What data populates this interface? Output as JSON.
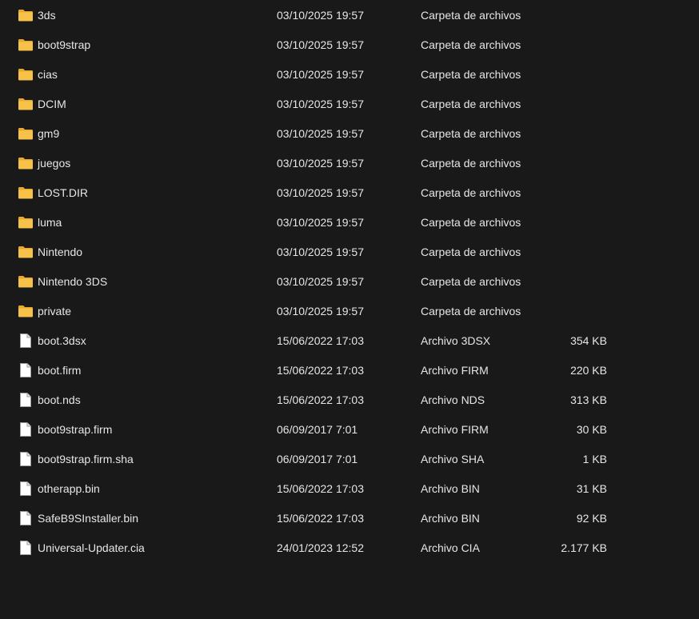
{
  "colors": {
    "background": "#191919",
    "text": "#e6e6e6",
    "folder": "#f7c24a",
    "file_fill": "#ffffff"
  },
  "files": [
    {
      "name": "3ds",
      "date": "03/10/2025 19:57",
      "type": "Carpeta de archivos",
      "size": "",
      "icon": "folder-icon"
    },
    {
      "name": "boot9strap",
      "date": "03/10/2025 19:57",
      "type": "Carpeta de archivos",
      "size": "",
      "icon": "folder-icon"
    },
    {
      "name": "cias",
      "date": "03/10/2025 19:57",
      "type": "Carpeta de archivos",
      "size": "",
      "icon": "folder-icon"
    },
    {
      "name": "DCIM",
      "date": "03/10/2025 19:57",
      "type": "Carpeta de archivos",
      "size": "",
      "icon": "folder-icon"
    },
    {
      "name": "gm9",
      "date": "03/10/2025 19:57",
      "type": "Carpeta de archivos",
      "size": "",
      "icon": "folder-icon"
    },
    {
      "name": "juegos",
      "date": "03/10/2025 19:57",
      "type": "Carpeta de archivos",
      "size": "",
      "icon": "folder-icon"
    },
    {
      "name": "LOST.DIR",
      "date": "03/10/2025 19:57",
      "type": "Carpeta de archivos",
      "size": "",
      "icon": "folder-icon"
    },
    {
      "name": "luma",
      "date": "03/10/2025 19:57",
      "type": "Carpeta de archivos",
      "size": "",
      "icon": "folder-icon"
    },
    {
      "name": "Nintendo",
      "date": "03/10/2025 19:57",
      "type": "Carpeta de archivos",
      "size": "",
      "icon": "folder-icon"
    },
    {
      "name": "Nintendo 3DS",
      "date": "03/10/2025 19:57",
      "type": "Carpeta de archivos",
      "size": "",
      "icon": "folder-icon"
    },
    {
      "name": "private",
      "date": "03/10/2025 19:57",
      "type": "Carpeta de archivos",
      "size": "",
      "icon": "folder-icon"
    },
    {
      "name": "boot.3dsx",
      "date": "15/06/2022 17:03",
      "type": "Archivo 3DSX",
      "size": "354 KB",
      "icon": "file-icon"
    },
    {
      "name": "boot.firm",
      "date": "15/06/2022 17:03",
      "type": "Archivo FIRM",
      "size": "220 KB",
      "icon": "file-icon"
    },
    {
      "name": "boot.nds",
      "date": "15/06/2022 17:03",
      "type": "Archivo NDS",
      "size": "313 KB",
      "icon": "file-icon"
    },
    {
      "name": "boot9strap.firm",
      "date": "06/09/2017 7:01",
      "type": "Archivo FIRM",
      "size": "30 KB",
      "icon": "file-icon"
    },
    {
      "name": "boot9strap.firm.sha",
      "date": "06/09/2017 7:01",
      "type": "Archivo SHA",
      "size": "1 KB",
      "icon": "file-icon"
    },
    {
      "name": "otherapp.bin",
      "date": "15/06/2022 17:03",
      "type": "Archivo BIN",
      "size": "31 KB",
      "icon": "file-icon"
    },
    {
      "name": "SafeB9SInstaller.bin",
      "date": "15/06/2022 17:03",
      "type": "Archivo BIN",
      "size": "92 KB",
      "icon": "file-icon"
    },
    {
      "name": "Universal-Updater.cia",
      "date": "24/01/2023 12:52",
      "type": "Archivo CIA",
      "size": "2.177 KB",
      "icon": "file-icon"
    }
  ]
}
